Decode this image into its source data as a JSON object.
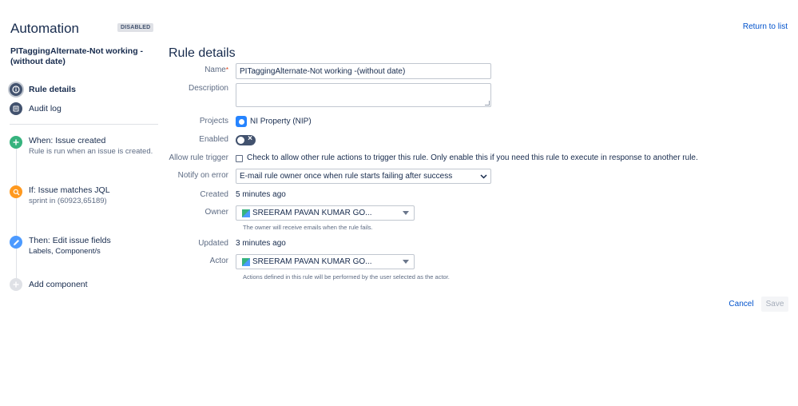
{
  "header": {
    "title": "Automation",
    "status_badge": "DISABLED",
    "return_link": "Return to list"
  },
  "sidebar": {
    "rule_name": "PITaggingAlternate-Not working -(without date)",
    "nav": [
      {
        "label": "Rule details",
        "icon": "info-icon",
        "active": true
      },
      {
        "label": "Audit log",
        "icon": "audit-log-icon",
        "active": false
      }
    ],
    "components": [
      {
        "title": "When: Issue created",
        "subtitle": "Rule is run when an issue is created.",
        "icon": "plus-icon",
        "color": "#36b37e"
      },
      {
        "title": "If: Issue matches JQL",
        "subtitle": "sprint in (60923,65189)",
        "icon": "search-icon",
        "color": "#ff991f"
      },
      {
        "title": "Then: Edit issue fields",
        "subtitle": "Labels, Component/s",
        "icon": "pencil-icon",
        "color": "#4c9aff"
      }
    ],
    "add_component": "Add component"
  },
  "form": {
    "section_title": "Rule details",
    "name_label": "Name",
    "required_mark": "*",
    "name_value": "PITaggingAlternate-Not working -(without date)",
    "description_label": "Description",
    "description_value": "",
    "projects_label": "Projects",
    "project_value": "NI Property (NIP)",
    "enabled_label": "Enabled",
    "enabled": false,
    "allow_trigger_label": "Allow rule trigger",
    "allow_trigger_text": "Check to allow other rule actions to trigger this rule. Only enable this if you need this rule to execute in response to another rule.",
    "allow_trigger_checked": false,
    "notify_label": "Notify on error",
    "notify_value": "E-mail rule owner once when rule starts failing after success",
    "created_label": "Created",
    "created_value": "5 minutes ago",
    "owner_label": "Owner",
    "owner_value": "SREERAM PAVAN KUMAR GO...",
    "owner_help": "The owner will receive emails when the rule fails.",
    "updated_label": "Updated",
    "updated_value": "3 minutes ago",
    "actor_label": "Actor",
    "actor_value": "SREERAM PAVAN KUMAR GO...",
    "actor_help": "Actions defined in this rule will be performed by the user selected as the actor."
  },
  "actions": {
    "cancel": "Cancel",
    "save": "Save"
  },
  "colors": {
    "link": "#0052cc",
    "trigger_green": "#36b37e",
    "condition_orange": "#ff991f",
    "action_blue": "#4c9aff"
  }
}
